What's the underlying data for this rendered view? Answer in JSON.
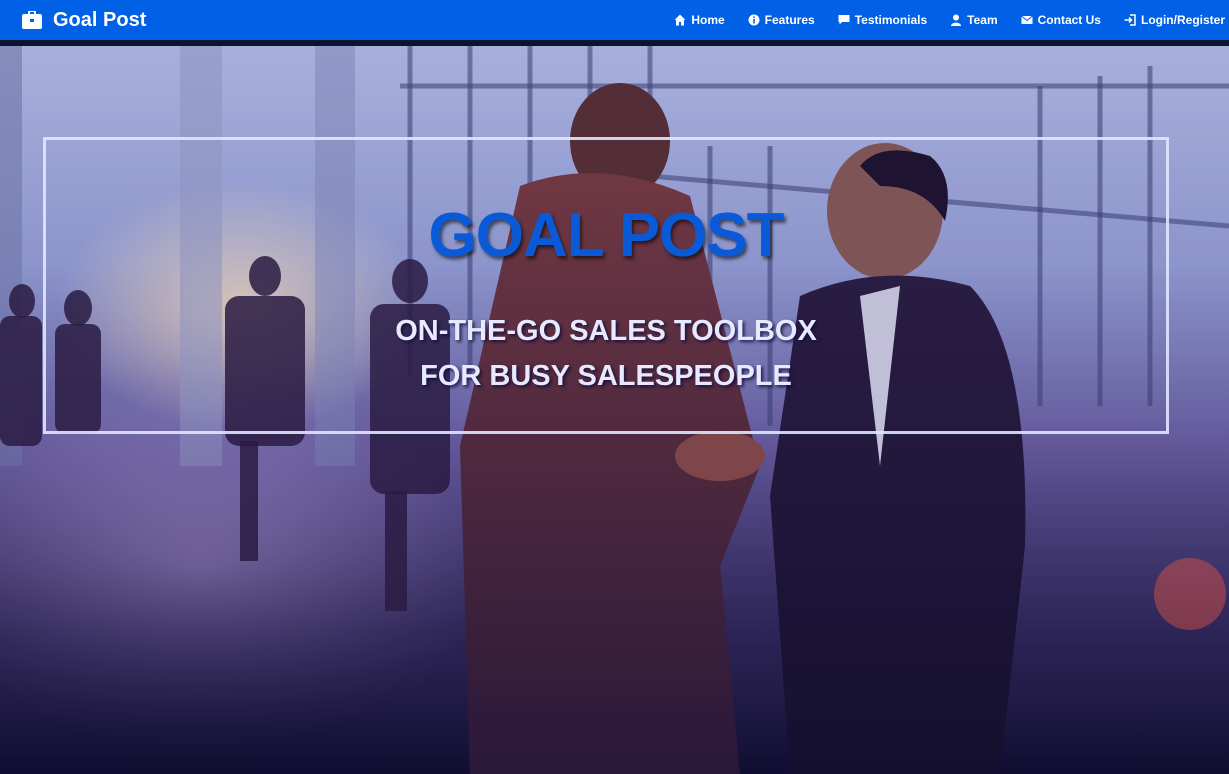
{
  "navbar": {
    "brand": "Goal Post",
    "brand_icon": "briefcase-icon",
    "background": "#0060e6",
    "items": [
      {
        "label": "Home",
        "icon": "home-icon"
      },
      {
        "label": "Features",
        "icon": "info-icon"
      },
      {
        "label": "Testimonials",
        "icon": "comment-icon"
      },
      {
        "label": "Team",
        "icon": "user-icon"
      },
      {
        "label": "Contact Us",
        "icon": "envelope-icon"
      },
      {
        "label": "Login/Register",
        "icon": "login-icon"
      }
    ]
  },
  "hero": {
    "title": "GOAL POST",
    "subtitle_line1": "ON-THE-GO SALES TOOLBOX",
    "subtitle_line2": "FOR BUSY SALESPEOPLE",
    "title_color": "#0a5ad8",
    "background_image": "business-handshake-photo"
  }
}
